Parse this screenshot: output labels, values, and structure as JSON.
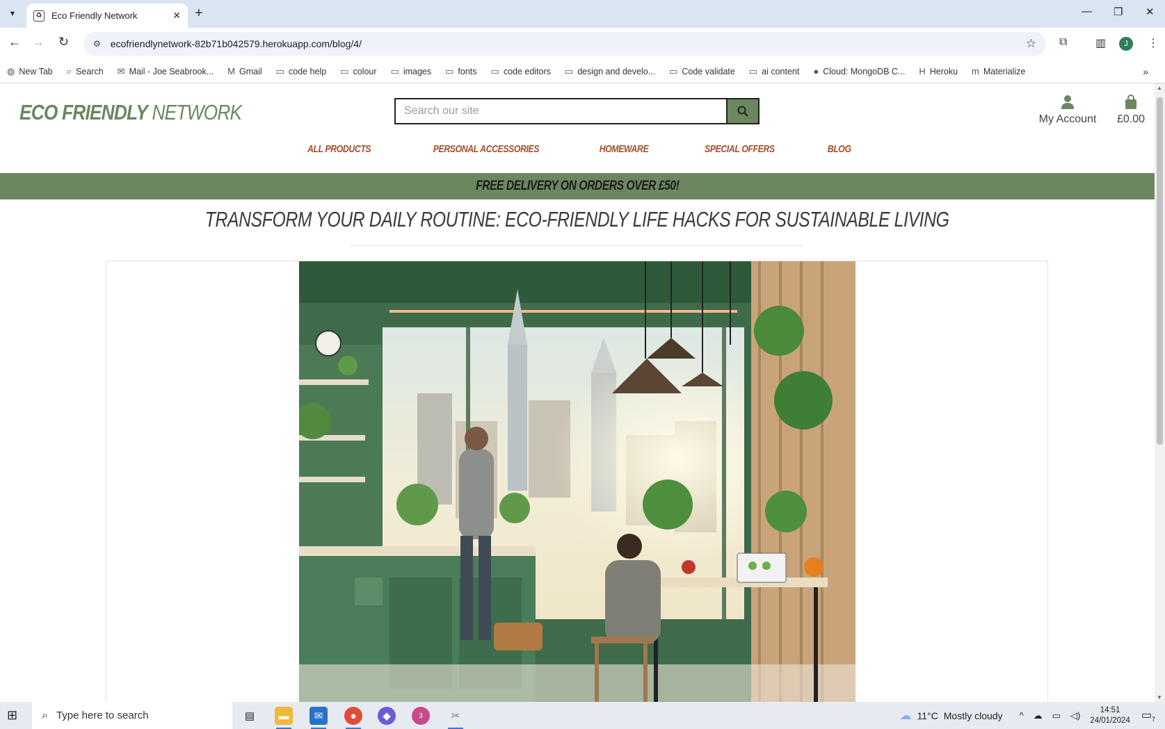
{
  "browser": {
    "tab_title": "Eco Friendly Network",
    "tab_close": "✕",
    "new_tab": "+",
    "url": "ecofriendlynetwork-82b71b042579.herokuapp.com/blog/4/",
    "profile_initial": "J",
    "bookmarks": [
      {
        "label": "New Tab",
        "icon": "globe-icon"
      },
      {
        "label": "Search",
        "icon": "search-icon"
      },
      {
        "label": "Mail - Joe Seabrook...",
        "icon": "outlook-icon"
      },
      {
        "label": "Gmail",
        "icon": "gmail-icon"
      },
      {
        "label": "code help",
        "icon": "folder-icon"
      },
      {
        "label": "colour",
        "icon": "folder-icon"
      },
      {
        "label": "images",
        "icon": "folder-icon"
      },
      {
        "label": "fonts",
        "icon": "folder-icon"
      },
      {
        "label": "code editors",
        "icon": "folder-icon"
      },
      {
        "label": "design and develo...",
        "icon": "folder-icon"
      },
      {
        "label": "Code validate",
        "icon": "folder-icon"
      },
      {
        "label": "ai content",
        "icon": "folder-icon"
      },
      {
        "label": "Cloud: MongoDB C...",
        "icon": "mongodb-icon"
      },
      {
        "label": "Heroku",
        "icon": "heroku-icon"
      },
      {
        "label": "Materialize",
        "icon": "materialize-icon"
      }
    ]
  },
  "site": {
    "logo_bold": "ECO FRIENDLY",
    "logo_light": "NETWORK",
    "search_placeholder": "Search our site",
    "account_label": "My Account",
    "bag_total": "£0.00",
    "nav": [
      "ALL PRODUCTS",
      "PERSONAL ACCESSORIES",
      "HOMEWARE",
      "SPECIAL OFFERS",
      "BLOG"
    ],
    "banner": "FREE DELIVERY ON ORDERS OVER £50!",
    "post_title": "TRANSFORM YOUR DAILY ROUTINE: ECO-FRIENDLY LIFE HACKS FOR SUSTAINABLE LIVING"
  },
  "taskbar": {
    "search_placeholder": "Type here to search",
    "weather_temp": "11°C",
    "weather_desc": "Mostly cloudy",
    "time": "14:51",
    "date": "24/01/2024",
    "notification_count": "7",
    "slack_badge": "3"
  },
  "colors": {
    "brand_green": "#6b8760",
    "nav_brown": "#a0522d"
  }
}
